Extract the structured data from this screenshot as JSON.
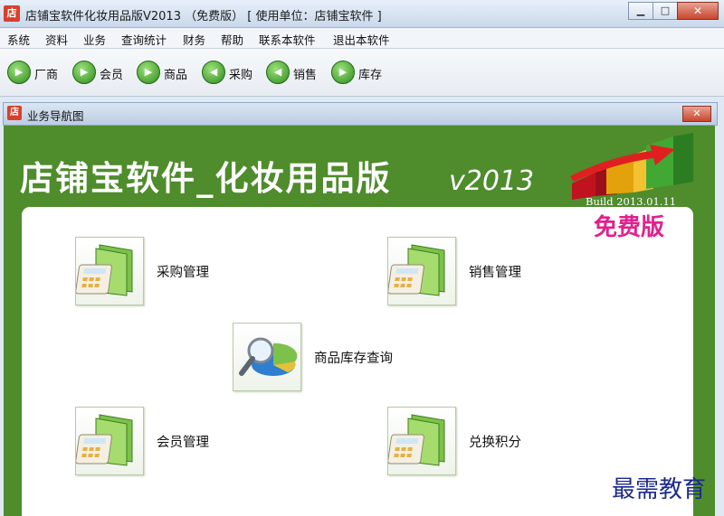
{
  "window": {
    "title": "店铺宝软件化妆用品版V2013 （免费版）  [ 使用单位：店铺宝软件 ]",
    "app_icon_char": "店"
  },
  "menu": [
    "系统",
    "资料",
    "业务",
    "查询统计",
    "财务",
    "帮助",
    "联系本软件",
    "退出本软件"
  ],
  "toolbar": [
    {
      "label": "厂商",
      "icon": "green-arrow-icon"
    },
    {
      "label": "会员",
      "icon": "green-arrow-icon"
    },
    {
      "label": "商品",
      "icon": "green-arrow-icon"
    },
    {
      "label": "采购",
      "icon": "green-arrow-icon"
    },
    {
      "label": "销售",
      "icon": "green-arrow-icon"
    },
    {
      "label": "库存",
      "icon": "green-arrow-icon"
    }
  ],
  "child_window": {
    "title": "业务导航图",
    "icon_char": "店"
  },
  "banner": {
    "title": "店铺宝软件_化妆用品版",
    "version": "v2013",
    "build": "Build 2013.01.11",
    "edition": "免费版"
  },
  "nav_items": [
    {
      "label": "采购管理",
      "icon": "calculator-folder-icon"
    },
    {
      "label": "销售管理",
      "icon": "calculator-folder-icon"
    },
    {
      "label": "商品库存查询",
      "icon": "magnifier-chart-icon"
    },
    {
      "label": "会员管理",
      "icon": "calculator-folder-icon"
    },
    {
      "label": "兑换积分",
      "icon": "calculator-folder-icon"
    }
  ],
  "watermark": "最需教育",
  "colors": {
    "workspace_green": "#4e8c2c",
    "edition_magenta": "#e0218e"
  }
}
